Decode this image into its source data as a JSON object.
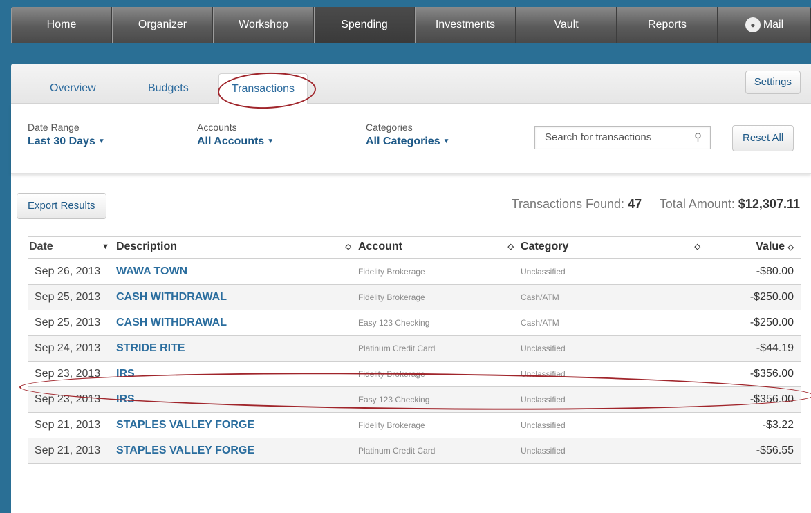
{
  "nav": {
    "items": [
      {
        "label": "Home",
        "width": 146
      },
      {
        "label": "Organizer",
        "width": 146
      },
      {
        "label": "Workshop",
        "width": 146
      },
      {
        "label": "Spending",
        "width": 146,
        "active": true
      },
      {
        "label": "Investments",
        "width": 146
      },
      {
        "label": "Vault",
        "width": 146
      },
      {
        "label": "Reports",
        "width": 146
      },
      {
        "label": "Mail",
        "width": 135
      }
    ]
  },
  "subnav": {
    "tabs": [
      "Overview",
      "Budgets",
      "Transactions"
    ],
    "settings": "Settings"
  },
  "filters": {
    "date_range": {
      "label": "Date Range",
      "value": "Last 30 Days"
    },
    "accounts": {
      "label": "Accounts",
      "value": "All Accounts"
    },
    "categories": {
      "label": "Categories",
      "value": "All Categories"
    }
  },
  "search": {
    "placeholder": "Search for transactions"
  },
  "reset_label": "Reset All",
  "export_label": "Export Results",
  "summary": {
    "found_label": "Transactions Found:",
    "found_count": "47",
    "total_label": "Total Amount:",
    "total_amount": "$12,307.11"
  },
  "table": {
    "headers": [
      "Date",
      "Description",
      "Account",
      "Category",
      "Value"
    ],
    "rows": [
      {
        "date": "Sep 26, 2013",
        "desc": "WAWA TOWN",
        "account": "Fidelity Brokerage",
        "category": "Unclassified",
        "value": "-$80.00"
      },
      {
        "date": "Sep 25, 2013",
        "desc": "CASH WITHDRAWAL",
        "account": "Fidelity Brokerage",
        "category": "Cash/ATM",
        "value": "-$250.00"
      },
      {
        "date": "Sep 25, 2013",
        "desc": "CASH WITHDRAWAL",
        "account": "Easy 123 Checking",
        "category": "Cash/ATM",
        "value": "-$250.00"
      },
      {
        "date": "Sep 24, 2013",
        "desc": "STRIDE RITE",
        "account": "Platinum Credit Card",
        "category": "Unclassified",
        "value": "-$44.19"
      },
      {
        "date": "Sep 23, 2013",
        "desc": "IRS",
        "account": "Fidelity Brokerage",
        "category": "Unclassified",
        "value": "-$356.00"
      },
      {
        "date": "Sep 23, 2013",
        "desc": "IRS",
        "account": "Easy 123 Checking",
        "category": "Unclassified",
        "value": "-$356.00"
      },
      {
        "date": "Sep 21, 2013",
        "desc": "STAPLES VALLEY FORGE",
        "account": "Fidelity Brokerage",
        "category": "Unclassified",
        "value": "-$3.22"
      },
      {
        "date": "Sep 21, 2013",
        "desc": "STAPLES VALLEY FORGE",
        "account": "Platinum Credit Card",
        "category": "Unclassified",
        "value": "-$56.55"
      }
    ]
  },
  "colors": {
    "accent": "#2a6d9e",
    "annotation": "#a0252b",
    "nav_bg": "#5b5b5b"
  }
}
